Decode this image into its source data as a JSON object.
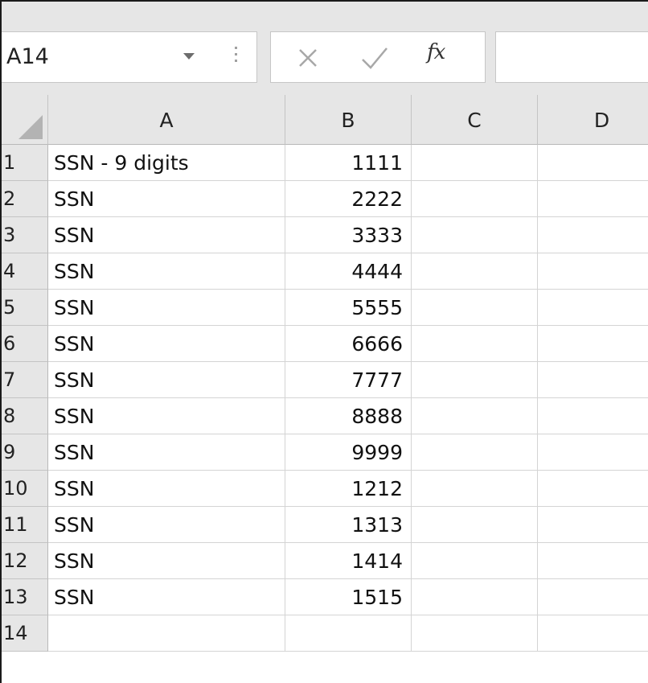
{
  "formula_bar": {
    "name_box": "A14",
    "fx_label": "fx",
    "formula_value": ""
  },
  "columns": [
    "A",
    "B",
    "C",
    "D"
  ],
  "rows": [
    {
      "num": "1",
      "a": "SSN - 9 digits",
      "b": "1111",
      "c": "",
      "d": ""
    },
    {
      "num": "2",
      "a": "SSN",
      "b": "2222",
      "c": "",
      "d": ""
    },
    {
      "num": "3",
      "a": "SSN",
      "b": "3333",
      "c": "",
      "d": ""
    },
    {
      "num": "4",
      "a": "SSN",
      "b": "4444",
      "c": "",
      "d": ""
    },
    {
      "num": "5",
      "a": "SSN",
      "b": "5555",
      "c": "",
      "d": ""
    },
    {
      "num": "6",
      "a": "SSN",
      "b": "6666",
      "c": "",
      "d": ""
    },
    {
      "num": "7",
      "a": "SSN",
      "b": "7777",
      "c": "",
      "d": ""
    },
    {
      "num": "8",
      "a": "SSN",
      "b": "8888",
      "c": "",
      "d": ""
    },
    {
      "num": "9",
      "a": "SSN",
      "b": "9999",
      "c": "",
      "d": ""
    },
    {
      "num": "10",
      "a": "SSN",
      "b": "1212",
      "c": "",
      "d": ""
    },
    {
      "num": "11",
      "a": "SSN",
      "b": "1313",
      "c": "",
      "d": ""
    },
    {
      "num": "12",
      "a": "SSN",
      "b": "1414",
      "c": "",
      "d": ""
    },
    {
      "num": "13",
      "a": "SSN",
      "b": "1515",
      "c": "",
      "d": ""
    },
    {
      "num": "14",
      "a": "",
      "b": "",
      "c": "",
      "d": ""
    }
  ]
}
